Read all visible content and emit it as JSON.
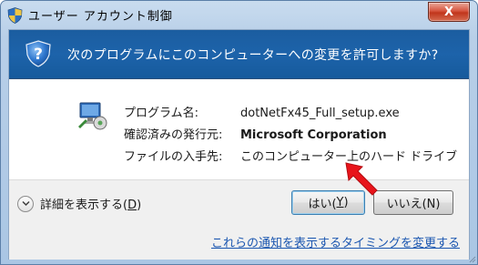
{
  "window": {
    "title": "ユーザー アカウント制御",
    "close_label": "X"
  },
  "banner": {
    "question": "次のプログラムにこのコンピューターへの変更を許可しますか?"
  },
  "details": {
    "program_label": "プログラム名:",
    "program_value": "dotNetFx45_Full_setup.exe",
    "publisher_label": "確認済みの発行元:",
    "publisher_value": "Microsoft Corporation",
    "origin_label": "ファイルの入手先:",
    "origin_value": "このコンピューター上のハード ドライブ"
  },
  "footer": {
    "show_details_text": "詳細を表示する(",
    "show_details_key": "D",
    "show_details_close": ")",
    "yes_text": "はい(",
    "yes_key": "Y",
    "yes_close": ")",
    "no_text": "いいえ(N)",
    "notification_link": "これらの通知を表示するタイミングを変更する"
  },
  "colors": {
    "banner": "#1d63aa",
    "link": "#1a56b0",
    "arrow": "#e8141b"
  },
  "icons": {
    "title": "uac-shield-icon",
    "banner": "help-question-icon",
    "program": "setup-program-icon",
    "details_toggle": "chevron-down-icon",
    "pointer": "red-arrow-icon"
  }
}
